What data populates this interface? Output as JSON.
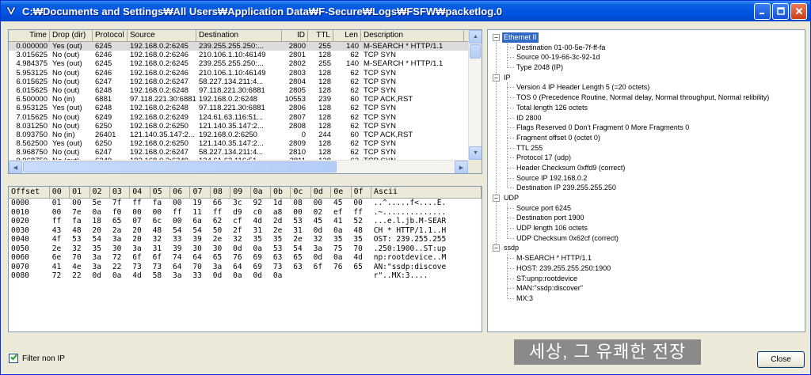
{
  "window": {
    "title": "C:₩Documents and Settings₩All Users₩Application Data₩F-Secure₩Logs₩FSFW₩packetlog.0"
  },
  "packets": {
    "columns": [
      "Time",
      "Drop (dir)",
      "Protocol",
      "Source",
      "Destination",
      "ID",
      "TTL",
      "Len",
      "Description"
    ],
    "rows": [
      [
        "0.000000",
        "Yes (out)",
        "6245",
        "192.168.0.2:6245",
        "239.255.255.250:...",
        "2800",
        "255",
        "140",
        "M-SEARCH * HTTP/1.1"
      ],
      [
        "3.015625",
        "No (out)",
        "6246",
        "192.168.0.2:6246",
        "210.106.1.10:46149",
        "2801",
        "128",
        "62",
        "TCP SYN"
      ],
      [
        "4.984375",
        "Yes (out)",
        "6245",
        "192.168.0.2:6245",
        "239.255.255.250:...",
        "2802",
        "255",
        "140",
        "M-SEARCH * HTTP/1.1"
      ],
      [
        "5.953125",
        "No (out)",
        "6246",
        "192.168.0.2:6246",
        "210.106.1.10:46149",
        "2803",
        "128",
        "62",
        "TCP SYN"
      ],
      [
        "6.015625",
        "No (out)",
        "6247",
        "192.168.0.2:6247",
        "58.227.134.211:4...",
        "2804",
        "128",
        "62",
        "TCP SYN"
      ],
      [
        "6.015625",
        "No (out)",
        "6248",
        "192.168.0.2:6248",
        "97.118.221.30:6881",
        "2805",
        "128",
        "62",
        "TCP SYN"
      ],
      [
        "6.500000",
        "No (in)",
        "6881",
        "97.118.221.30:6881",
        "192.168.0.2:6248",
        "10553",
        "239",
        "60",
        "TCP ACK,RST"
      ],
      [
        "6.953125",
        "Yes (out)",
        "6248",
        "192.168.0.2:6248",
        "97.118.221.30:6881",
        "2806",
        "128",
        "62",
        "TCP SYN"
      ],
      [
        "7.015625",
        "No (out)",
        "6249",
        "192.168.0.2:6249",
        "124.61.63.116:51...",
        "2807",
        "128",
        "62",
        "TCP SYN"
      ],
      [
        "8.031250",
        "No (out)",
        "6250",
        "192.168.0.2:6250",
        "121.140.35.147:2...",
        "2808",
        "128",
        "62",
        "TCP SYN"
      ],
      [
        "8.093750",
        "No (in)",
        "26401",
        "121.140.35.147:2...",
        "192.168.0.2:6250",
        "0",
        "244",
        "60",
        "TCP ACK,RST"
      ],
      [
        "8.562500",
        "Yes (out)",
        "6250",
        "192.168.0.2:6250",
        "121.140.35.147:2...",
        "2809",
        "128",
        "62",
        "TCP SYN"
      ],
      [
        "8.968750",
        "No (out)",
        "6247",
        "192.168.0.2:6247",
        "58.227.134.211:4...",
        "2810",
        "128",
        "62",
        "TCP SYN"
      ],
      [
        "9.968750",
        "No (out)",
        "6249",
        "192.168.0.2:6249",
        "124.61.63.116:51...",
        "2811",
        "128",
        "62",
        "TCP SYN"
      ]
    ]
  },
  "hex": {
    "columns": [
      "Offset",
      "00",
      "01",
      "02",
      "03",
      "04",
      "05",
      "06",
      "07",
      "08",
      "09",
      "0a",
      "0b",
      "0c",
      "0d",
      "0e",
      "0f",
      "Ascii"
    ],
    "rows": [
      [
        "0000",
        "01",
        "00",
        "5e",
        "7f",
        "ff",
        "fa",
        "00",
        "19",
        "66",
        "3c",
        "92",
        "1d",
        "08",
        "00",
        "45",
        "00",
        "..^.....f<....E."
      ],
      [
        "0010",
        "00",
        "7e",
        "0a",
        "f0",
        "00",
        "00",
        "ff",
        "11",
        "ff",
        "d9",
        "c0",
        "a8",
        "00",
        "02",
        "ef",
        "ff",
        ".~.............."
      ],
      [
        "0020",
        "ff",
        "fa",
        "18",
        "65",
        "07",
        "6c",
        "00",
        "6a",
        "62",
        "cf",
        "4d",
        "2d",
        "53",
        "45",
        "41",
        "52",
        "...e.l.jb.M-SEAR"
      ],
      [
        "0030",
        "43",
        "48",
        "20",
        "2a",
        "20",
        "48",
        "54",
        "54",
        "50",
        "2f",
        "31",
        "2e",
        "31",
        "0d",
        "0a",
        "48",
        "CH * HTTP/1.1..H"
      ],
      [
        "0040",
        "4f",
        "53",
        "54",
        "3a",
        "20",
        "32",
        "33",
        "39",
        "2e",
        "32",
        "35",
        "35",
        "2e",
        "32",
        "35",
        "35",
        "OST: 239.255.255"
      ],
      [
        "0050",
        "2e",
        "32",
        "35",
        "30",
        "3a",
        "31",
        "39",
        "30",
        "30",
        "0d",
        "0a",
        "53",
        "54",
        "3a",
        "75",
        "70",
        ".250:1900..ST:up"
      ],
      [
        "0060",
        "6e",
        "70",
        "3a",
        "72",
        "6f",
        "6f",
        "74",
        "64",
        "65",
        "76",
        "69",
        "63",
        "65",
        "0d",
        "0a",
        "4d",
        "np:rootdevice..M"
      ],
      [
        "0070",
        "41",
        "4e",
        "3a",
        "22",
        "73",
        "73",
        "64",
        "70",
        "3a",
        "64",
        "69",
        "73",
        "63",
        "6f",
        "76",
        "65",
        "AN:\"ssdp:discove"
      ],
      [
        "0080",
        "72",
        "22",
        "0d",
        "0a",
        "4d",
        "58",
        "3a",
        "33",
        "0d",
        "0a",
        "0d",
        "0a",
        "",
        "",
        "",
        "",
        "r\"..MX:3...."
      ]
    ]
  },
  "tree": [
    {
      "kind": "group",
      "label": "Ethernet II",
      "toggle": "−",
      "selected": true
    },
    {
      "kind": "leaf",
      "label": "Destination 01-00-5e-7f-ff-fa"
    },
    {
      "kind": "leaf",
      "label": "Source 00-19-66-3c-92-1d"
    },
    {
      "kind": "leaf",
      "label": "Type 2048 (IP)"
    },
    {
      "kind": "group",
      "label": "IP",
      "toggle": "−"
    },
    {
      "kind": "leaf",
      "label": "Version 4 IP Header Length 5 (=20 octets)"
    },
    {
      "kind": "leaf",
      "label": "TOS 0 (Precedence Routine, Normal delay, Normal throughput, Normal relibility)"
    },
    {
      "kind": "leaf",
      "label": "Total length 126 octets"
    },
    {
      "kind": "leaf",
      "label": "ID 2800"
    },
    {
      "kind": "leaf",
      "label": "Flags Reserved 0 Don't Fragment 0 More Fragments 0"
    },
    {
      "kind": "leaf",
      "label": "Fragment offset 0 (octet 0)"
    },
    {
      "kind": "leaf",
      "label": "TTL 255"
    },
    {
      "kind": "leaf",
      "label": "Protocol 17 (udp)"
    },
    {
      "kind": "leaf",
      "label": "Header Checksum 0xffd9 (correct)"
    },
    {
      "kind": "leaf",
      "label": "Source IP 192.168.0.2"
    },
    {
      "kind": "leaf",
      "label": "Destination IP 239.255.255.250"
    },
    {
      "kind": "group",
      "label": "UDP",
      "toggle": "−"
    },
    {
      "kind": "leaf",
      "label": "Source port 6245"
    },
    {
      "kind": "leaf",
      "label": "Destination port 1900"
    },
    {
      "kind": "leaf",
      "label": "UDP length 106 octets"
    },
    {
      "kind": "leaf",
      "label": "UDP Checksum 0x62cf (correct)"
    },
    {
      "kind": "group",
      "label": "ssdp",
      "toggle": "−"
    },
    {
      "kind": "leaf",
      "label": "M-SEARCH * HTTP/1.1"
    },
    {
      "kind": "leaf",
      "label": "HOST: 239.255.255.250:1900"
    },
    {
      "kind": "leaf",
      "label": "ST:upnp:rootdevice"
    },
    {
      "kind": "leaf",
      "label": "MAN:\"ssdp:discover\""
    },
    {
      "kind": "leaf",
      "label": "MX:3"
    }
  ],
  "footer": {
    "filter_label": "Filter non IP",
    "filter_checked": true,
    "watermark": "세상, 그 유쾌한 전장",
    "close_label": "Close"
  },
  "colors": {
    "title_bar": "#0054e3",
    "selection": "#316ac5",
    "selected_row": "#dcdcdc",
    "checkmark": "#21a121"
  },
  "icons": {
    "app": "f-secure-v-icon",
    "minimize": "minimize-icon",
    "maximize": "maximize-icon",
    "close": "close-icon",
    "check": "checkmark-icon"
  }
}
